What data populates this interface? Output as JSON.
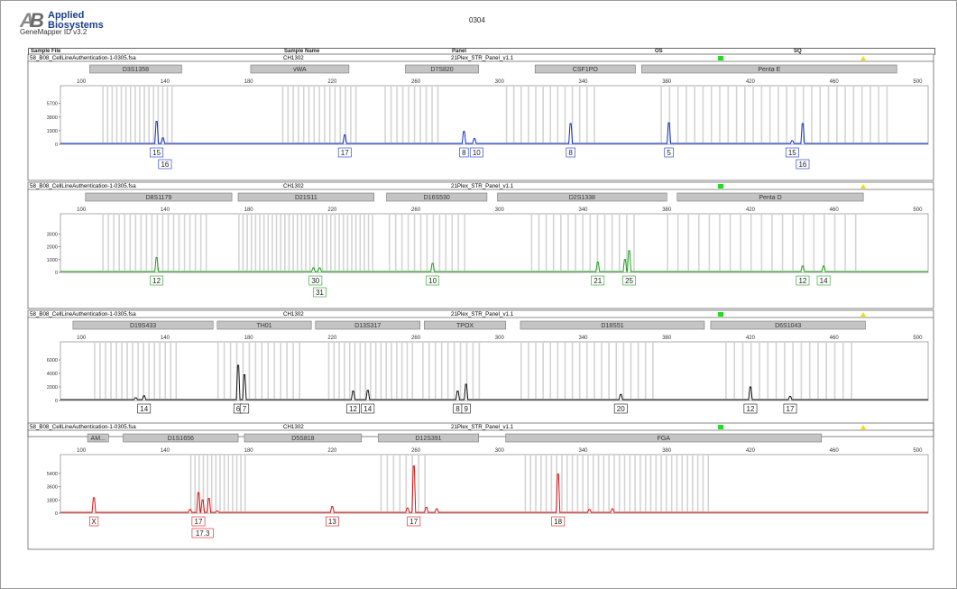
{
  "header": {
    "brand_line1": "Applied",
    "brand_line2": "Biosystems",
    "app_name": "GeneMapper ID v3.2",
    "page_title": "0304"
  },
  "table_header": {
    "sample_file": "Sample File",
    "sample_name": "Sample Name",
    "panel": "Panel",
    "os": "OS",
    "sq": "SQ"
  },
  "status_colors": {
    "os": "#22dd22",
    "sq": "#f0e000"
  },
  "panels": [
    {
      "sample_file": "58_B08_CellLineAuthentication-1-0305.fsa",
      "sample_name": "CH1302",
      "panel_name": "21Plex_STR_Panel_v1.1",
      "color": "#1030c8",
      "loci": [
        {
          "name": "D3S1358",
          "start": 104,
          "end": 148
        },
        {
          "name": "vWA",
          "start": 181,
          "end": 228
        },
        {
          "name": "D7S820",
          "start": 255,
          "end": 290
        },
        {
          "name": "CSF1PO",
          "start": 317,
          "end": 365
        },
        {
          "name": "Penta E",
          "start": 368,
          "end": 490
        }
      ],
      "bins": [
        [
          110,
          143,
          2.2
        ],
        [
          196,
          232,
          2.5
        ],
        [
          245,
          273,
          2.8
        ],
        [
          303,
          345,
          3.5
        ],
        [
          377,
          485,
          4.0
        ]
      ],
      "y_ticks": [
        0,
        1900,
        3800,
        5700
      ],
      "y_max": 6800,
      "peaks": [
        [
          136,
          3200
        ],
        [
          139,
          900
        ],
        [
          226,
          1300
        ],
        [
          283,
          1800
        ],
        [
          288,
          800
        ],
        [
          334,
          2900
        ],
        [
          381,
          3000
        ],
        [
          440,
          500
        ],
        [
          445,
          2900
        ]
      ],
      "allele_labels": [
        {
          "x": 136,
          "text": "15",
          "row": 0
        },
        {
          "x": 140,
          "text": "16",
          "row": 1
        },
        {
          "x": 226,
          "text": "17",
          "row": 0
        },
        {
          "x": 283,
          "text": "8",
          "row": 0
        },
        {
          "x": 289,
          "text": "10",
          "row": 0
        },
        {
          "x": 334,
          "text": "8",
          "row": 0
        },
        {
          "x": 381,
          "text": "5",
          "row": 0
        },
        {
          "x": 440,
          "text": "15",
          "row": 0
        },
        {
          "x": 445,
          "text": "16",
          "row": 1
        }
      ]
    },
    {
      "sample_file": "58_B08_CellLineAuthentication-1-0305.fsa",
      "sample_name": "CH1302",
      "panel_name": "21Plex_STR_Panel_v1.1",
      "color": "#20a020",
      "loci": [
        {
          "name": "D8S1179",
          "start": 102,
          "end": 172
        },
        {
          "name": "D21S11",
          "start": 175,
          "end": 240
        },
        {
          "name": "D16S530",
          "start": 246,
          "end": 294
        },
        {
          "name": "D2S1338",
          "start": 299,
          "end": 380
        },
        {
          "name": "Penta D",
          "start": 385,
          "end": 474
        }
      ],
      "bins": [
        [
          110,
          160,
          2.6
        ],
        [
          175,
          240,
          2.0
        ],
        [
          247,
          285,
          3.0
        ],
        [
          315,
          365,
          3.5
        ],
        [
          380,
          470,
          5.0
        ]
      ],
      "y_ticks": [
        0,
        1000,
        2000,
        3000
      ],
      "y_max": 3800,
      "peaks": [
        [
          136,
          1150
        ],
        [
          211,
          350
        ],
        [
          214,
          350
        ],
        [
          268,
          700
        ],
        [
          347,
          800
        ],
        [
          360,
          1000
        ],
        [
          362,
          1700
        ],
        [
          445,
          500
        ],
        [
          455,
          500
        ]
      ],
      "allele_labels": [
        {
          "x": 136,
          "text": "12",
          "row": 0
        },
        {
          "x": 212,
          "text": "30",
          "row": 0
        },
        {
          "x": 214,
          "text": "31",
          "row": 1
        },
        {
          "x": 268,
          "text": "10",
          "row": 0
        },
        {
          "x": 347,
          "text": "21",
          "row": 0
        },
        {
          "x": 362,
          "text": "25",
          "row": 0
        },
        {
          "x": 445,
          "text": "12",
          "row": 0
        },
        {
          "x": 455,
          "text": "14",
          "row": 0
        }
      ]
    },
    {
      "sample_file": "58_B08_CellLineAuthentication-1-0305.fsa",
      "sample_name": "CH1302",
      "panel_name": "21Plex_STR_Panel_v1.1",
      "color": "#111111",
      "loci": [
        {
          "name": "D19S433",
          "start": 96,
          "end": 163
        },
        {
          "name": "TH01",
          "start": 165,
          "end": 210
        },
        {
          "name": "D13S317",
          "start": 212,
          "end": 262
        },
        {
          "name": "TPOX",
          "start": 264,
          "end": 303
        },
        {
          "name": "D18S51",
          "start": 310,
          "end": 398
        },
        {
          "name": "D6S1043",
          "start": 401,
          "end": 475
        }
      ],
      "bins": [
        [
          106,
          145,
          2.6
        ],
        [
          165,
          205,
          3.0
        ],
        [
          218,
          260,
          2.5
        ],
        [
          263,
          290,
          3.0
        ],
        [
          310,
          375,
          3.5
        ],
        [
          408,
          470,
          4.0
        ]
      ],
      "y_ticks": [
        0,
        2000,
        4000,
        6000
      ],
      "y_max": 7200,
      "peaks": [
        [
          126,
          400
        ],
        [
          130,
          700
        ],
        [
          175,
          5200
        ],
        [
          178,
          3800
        ],
        [
          230,
          1400
        ],
        [
          237,
          1500
        ],
        [
          280,
          1400
        ],
        [
          284,
          2400
        ],
        [
          358,
          900
        ],
        [
          420,
          2000
        ],
        [
          439,
          600
        ]
      ],
      "allele_labels": [
        {
          "x": 130,
          "text": "14",
          "row": 0
        },
        {
          "x": 175,
          "text": "6",
          "row": 0
        },
        {
          "x": 178,
          "text": "7",
          "row": 0
        },
        {
          "x": 230,
          "text": "12",
          "row": 0
        },
        {
          "x": 237,
          "text": "14",
          "row": 0
        },
        {
          "x": 280,
          "text": "8",
          "row": 0
        },
        {
          "x": 284,
          "text": "9",
          "row": 0
        },
        {
          "x": 358,
          "text": "20",
          "row": 0
        },
        {
          "x": 420,
          "text": "12",
          "row": 0
        },
        {
          "x": 439,
          "text": "17",
          "row": 0
        }
      ]
    },
    {
      "sample_file": "58_B08_CellLineAuthentication-1-0305.fsa",
      "sample_name": "CH1302",
      "panel_name": "21Plex_STR_Panel_v1.1",
      "color": "#dd1111",
      "loci": [
        {
          "name": "AM...",
          "start": 103,
          "end": 113
        },
        {
          "name": "D1S1656",
          "start": 120,
          "end": 175
        },
        {
          "name": "D5S818",
          "start": 178,
          "end": 234
        },
        {
          "name": "D12S391",
          "start": 242,
          "end": 290
        },
        {
          "name": "FGA",
          "start": 303,
          "end": 454
        }
      ],
      "bins": [
        [
          152,
          178,
          2.0
        ],
        [
          243,
          265,
          3.0
        ],
        [
          312,
          400,
          2.5
        ]
      ],
      "y_ticks": [
        0,
        1800,
        3600,
        5400
      ],
      "y_max": 6600,
      "peaks": [
        [
          106,
          2100
        ],
        [
          152,
          500
        ],
        [
          156,
          2800
        ],
        [
          158,
          1800
        ],
        [
          161,
          2000
        ],
        [
          165,
          300
        ],
        [
          220,
          900
        ],
        [
          256,
          700
        ],
        [
          259,
          6400
        ],
        [
          265,
          800
        ],
        [
          270,
          600
        ],
        [
          328,
          5300
        ],
        [
          343,
          500
        ],
        [
          354,
          600
        ]
      ],
      "allele_labels": [
        {
          "x": 106,
          "text": "X",
          "row": 0
        },
        {
          "x": 156,
          "text": "17",
          "row": 0
        },
        {
          "x": 158,
          "text": "17.3",
          "row": 1
        },
        {
          "x": 220,
          "text": "13",
          "row": 0
        },
        {
          "x": 259,
          "text": "17",
          "row": 0
        },
        {
          "x": 328,
          "text": "18",
          "row": 0
        }
      ]
    }
  ],
  "chart_data": {
    "type": "line",
    "x_ticks": [
      100,
      140,
      180,
      220,
      260,
      300,
      340,
      380,
      420,
      460,
      500
    ],
    "x_range": [
      90,
      505
    ],
    "series": [
      {
        "name": "CH1302",
        "peaks": [
          [
            136,
            3200
          ],
          [
            139,
            900
          ],
          [
            226,
            1300
          ],
          [
            283,
            1800
          ],
          [
            288,
            800
          ],
          [
            334,
            2900
          ],
          [
            381,
            3000
          ],
          [
            440,
            500
          ],
          [
            445,
            2900
          ]
        ]
      },
      {
        "name": "CH1302",
        "peaks": [
          [
            136,
            1150
          ],
          [
            211,
            350
          ],
          [
            214,
            350
          ],
          [
            268,
            700
          ],
          [
            347,
            800
          ],
          [
            360,
            1000
          ],
          [
            362,
            1700
          ],
          [
            445,
            500
          ],
          [
            455,
            500
          ]
        ]
      },
      {
        "name": "CH1302",
        "peaks": [
          [
            126,
            400
          ],
          [
            130,
            700
          ],
          [
            175,
            5200
          ],
          [
            178,
            3800
          ],
          [
            230,
            1400
          ],
          [
            237,
            1500
          ],
          [
            280,
            1400
          ],
          [
            284,
            2400
          ],
          [
            358,
            900
          ],
          [
            420,
            2000
          ],
          [
            439,
            600
          ]
        ]
      },
      {
        "name": "CH1302",
        "peaks": [
          [
            106,
            2100
          ],
          [
            152,
            500
          ],
          [
            156,
            2800
          ],
          [
            158,
            1800
          ],
          [
            161,
            2000
          ],
          [
            165,
            300
          ],
          [
            220,
            900
          ],
          [
            256,
            700
          ],
          [
            259,
            6400
          ],
          [
            265,
            800
          ],
          [
            270,
            600
          ],
          [
            328,
            5300
          ],
          [
            343,
            500
          ],
          [
            354,
            600
          ]
        ]
      }
    ]
  }
}
